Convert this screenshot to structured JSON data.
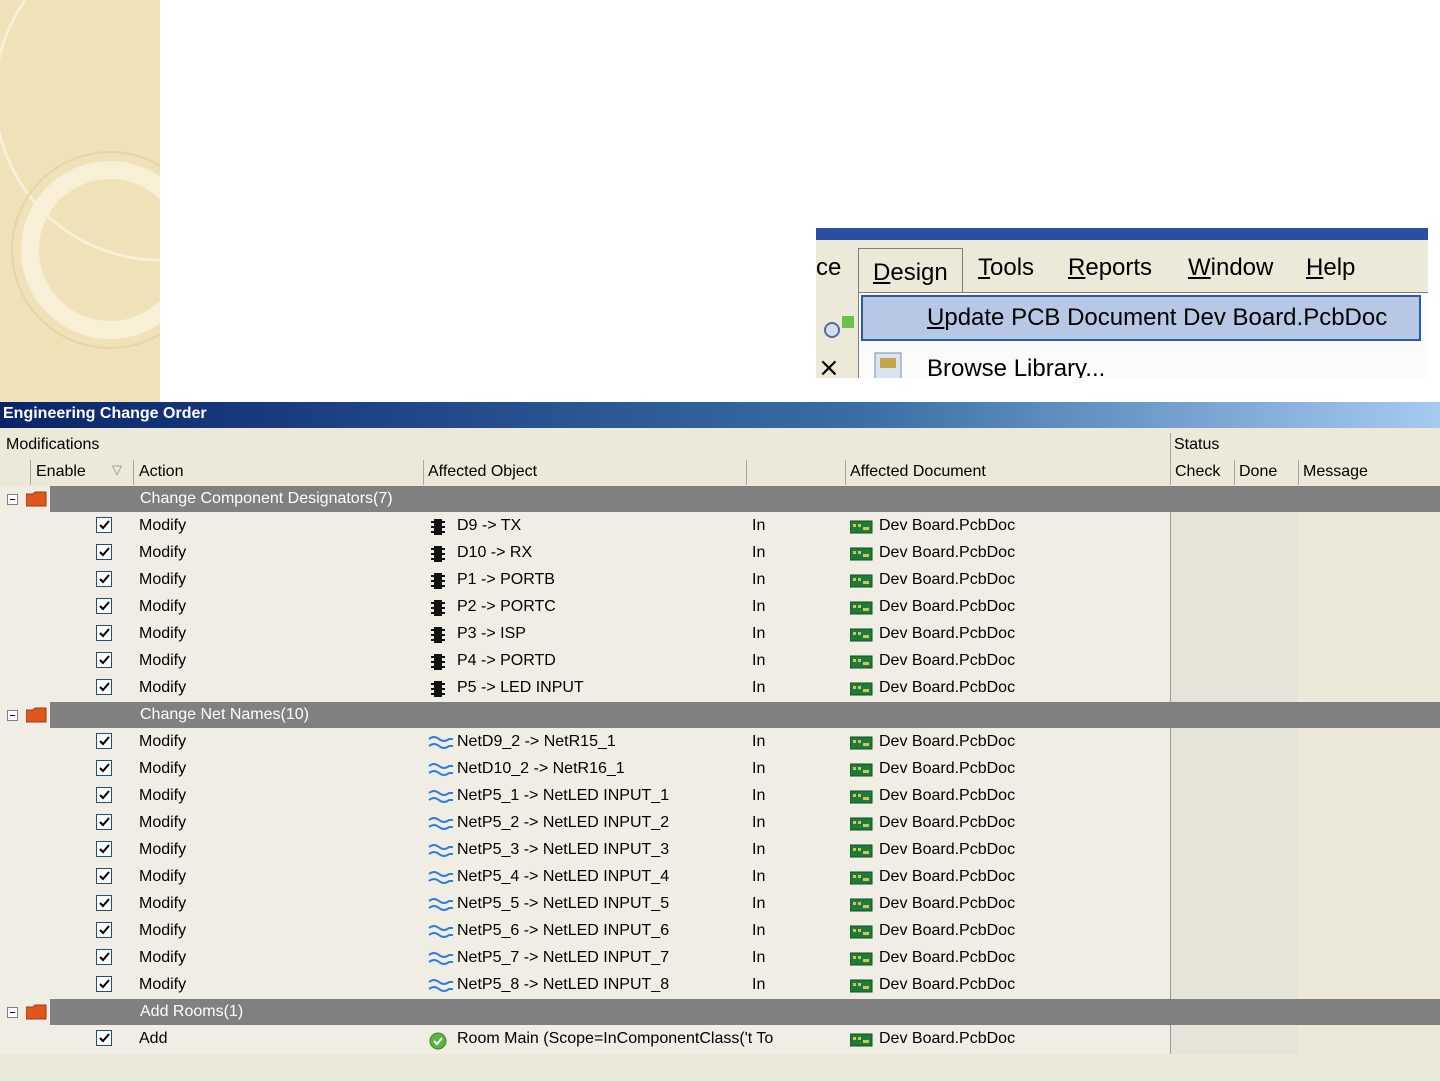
{
  "menu": {
    "items": [
      {
        "label": "ce",
        "u": ""
      },
      {
        "label": "Design",
        "u": "D"
      },
      {
        "label": "Tools",
        "u": "T"
      },
      {
        "label": "Reports",
        "u": "R"
      },
      {
        "label": "Window",
        "u": "W"
      },
      {
        "label": "Help",
        "u": "H"
      }
    ],
    "highlighted_item": "Update PCB Document Dev Board.PcbDoc",
    "next_item": "Browse Library..."
  },
  "eco": {
    "title": "Engineering Change Order",
    "sections": {
      "modifications": "Modifications",
      "status": "Status"
    },
    "columns": {
      "enable": "Enable",
      "action": "Action",
      "affected_object": "Affected Object",
      "affected_document": "Affected Document",
      "check": "Check",
      "done": "Done",
      "message": "Message"
    },
    "groups": [
      {
        "label": "Change Component Designators(7)",
        "icon": "component-icon",
        "rows": [
          {
            "action": "Modify",
            "object": "D9 -> TX",
            "rel": "In",
            "doc": "Dev Board.PcbDoc"
          },
          {
            "action": "Modify",
            "object": "D10 -> RX",
            "rel": "In",
            "doc": "Dev Board.PcbDoc"
          },
          {
            "action": "Modify",
            "object": "P1 -> PORTB",
            "rel": "In",
            "doc": "Dev Board.PcbDoc"
          },
          {
            "action": "Modify",
            "object": "P2 -> PORTC",
            "rel": "In",
            "doc": "Dev Board.PcbDoc"
          },
          {
            "action": "Modify",
            "object": "P3 -> ISP",
            "rel": "In",
            "doc": "Dev Board.PcbDoc"
          },
          {
            "action": "Modify",
            "object": "P4 -> PORTD",
            "rel": "In",
            "doc": "Dev Board.PcbDoc"
          },
          {
            "action": "Modify",
            "object": "P5 -> LED INPUT",
            "rel": "In",
            "doc": "Dev Board.PcbDoc"
          }
        ]
      },
      {
        "label": "Change Net Names(10)",
        "icon": "net-icon",
        "rows": [
          {
            "action": "Modify",
            "object": "NetD9_2 -> NetR15_1",
            "rel": "In",
            "doc": "Dev Board.PcbDoc"
          },
          {
            "action": "Modify",
            "object": "NetD10_2 -> NetR16_1",
            "rel": "In",
            "doc": "Dev Board.PcbDoc"
          },
          {
            "action": "Modify",
            "object": "NetP5_1 -> NetLED INPUT_1",
            "rel": "In",
            "doc": "Dev Board.PcbDoc"
          },
          {
            "action": "Modify",
            "object": "NetP5_2 -> NetLED INPUT_2",
            "rel": "In",
            "doc": "Dev Board.PcbDoc"
          },
          {
            "action": "Modify",
            "object": "NetP5_3 -> NetLED INPUT_3",
            "rel": "In",
            "doc": "Dev Board.PcbDoc"
          },
          {
            "action": "Modify",
            "object": "NetP5_4 -> NetLED INPUT_4",
            "rel": "In",
            "doc": "Dev Board.PcbDoc"
          },
          {
            "action": "Modify",
            "object": "NetP5_5 -> NetLED INPUT_5",
            "rel": "In",
            "doc": "Dev Board.PcbDoc"
          },
          {
            "action": "Modify",
            "object": "NetP5_6 -> NetLED INPUT_6",
            "rel": "In",
            "doc": "Dev Board.PcbDoc"
          },
          {
            "action": "Modify",
            "object": "NetP5_7 -> NetLED INPUT_7",
            "rel": "In",
            "doc": "Dev Board.PcbDoc"
          },
          {
            "action": "Modify",
            "object": "NetP5_8 -> NetLED INPUT_8",
            "rel": "In",
            "doc": "Dev Board.PcbDoc"
          }
        ]
      },
      {
        "label": "Add Rooms(1)",
        "icon": "room-icon",
        "rows": [
          {
            "action": "Add",
            "object": "Room Main (Scope=InComponentClass('t To",
            "rel": "",
            "doc": "Dev Board.PcbDoc"
          }
        ]
      }
    ]
  },
  "colors": {
    "title_start": "#0a246a",
    "title_end": "#a6caf0",
    "group_row": "#808080",
    "window_bg": "#ece9d8",
    "menu_highlight": "#b6c8e6"
  }
}
